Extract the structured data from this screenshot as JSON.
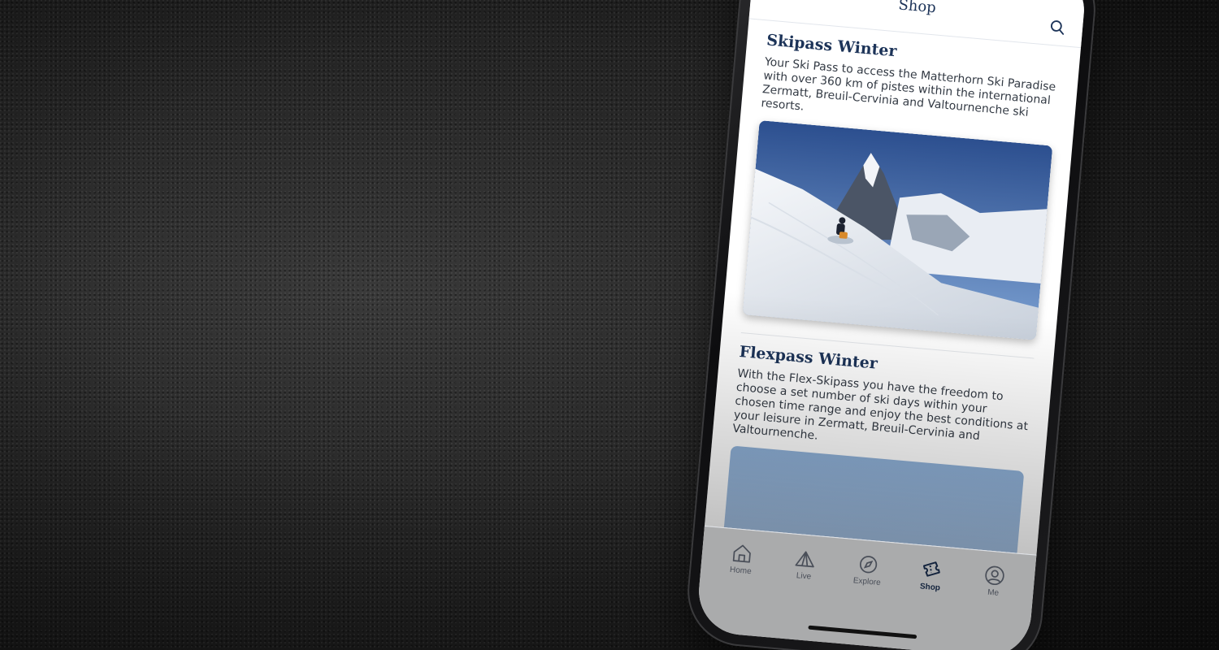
{
  "app": {
    "title": "Shop"
  },
  "sections": [
    {
      "title": "Skipass Winter",
      "description": "Your Ski Pass to access the Matterhorn Ski Paradise with over 360 km of pistes within the international Zermatt, Breuil-Cervinia and Valtournenche ski resorts."
    },
    {
      "title": "Flexpass Winter",
      "description": "With the Flex-Skipass you have the freedom to choose a set number of ski days within your chosen time range and enjoy the best conditions at your leisure in Zermatt, Breuil-Cervinia and Valtournenche."
    }
  ],
  "tabs": [
    {
      "label": "Home",
      "icon": "home-icon"
    },
    {
      "label": "Live",
      "icon": "live-icon"
    },
    {
      "label": "Explore",
      "icon": "compass-icon"
    },
    {
      "label": "Shop",
      "icon": "ticket-icon",
      "active": true
    },
    {
      "label": "Me",
      "icon": "user-icon"
    }
  ],
  "colors": {
    "brand_navy": "#1c3358",
    "record_red": "#e23b3b"
  }
}
